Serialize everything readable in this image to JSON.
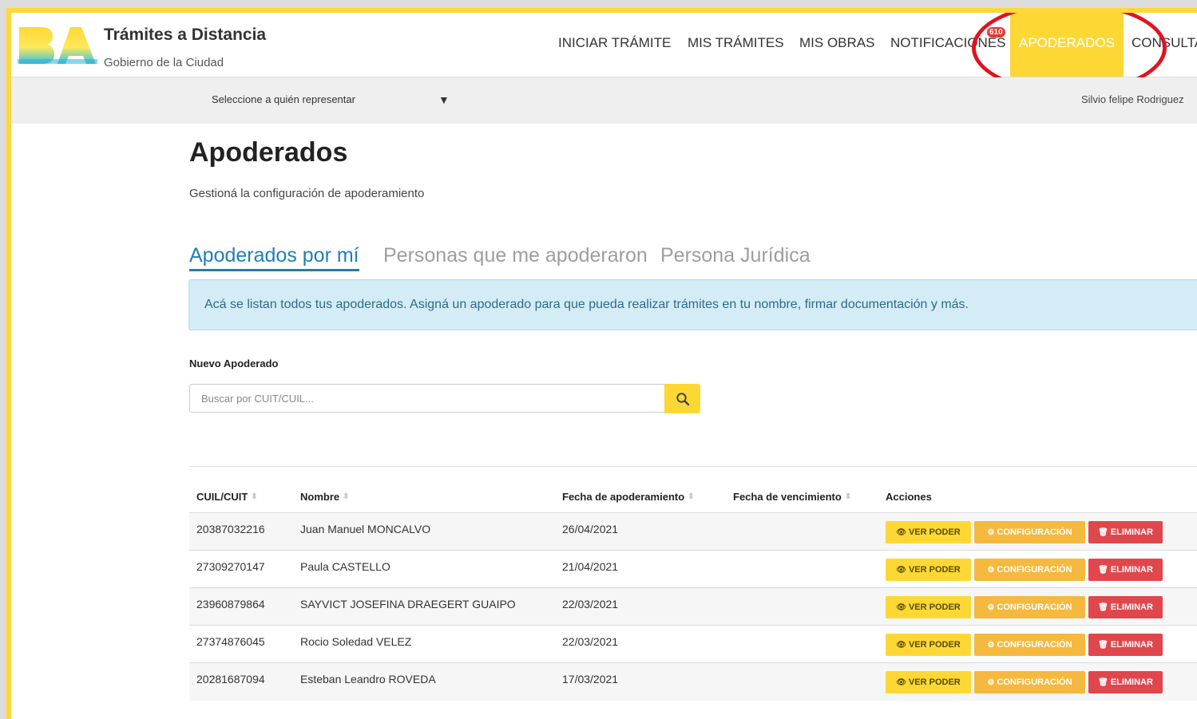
{
  "app": {
    "title": "Trámites a Distancia",
    "subtitle": "Gobierno de la Ciudad",
    "logo_text": "BA"
  },
  "nav": {
    "items": [
      {
        "label": "INICIAR TRÁMITE"
      },
      {
        "label": "MIS TRÁMITES"
      },
      {
        "label": "MIS OBRAS"
      },
      {
        "label": "NOTIFICACIONES",
        "badge": "610"
      },
      {
        "label": "APODERADOS",
        "active": true
      },
      {
        "label": "CONSULTA"
      }
    ]
  },
  "subbar": {
    "represent_label": "Seleccione a quién representar",
    "caret": "▼",
    "user_name": "Silvio felipe Rodriguez"
  },
  "page": {
    "title": "Apoderados",
    "description": "Gestioná la configuración de apoderamiento"
  },
  "tabs": [
    {
      "label": "Apoderados por mí",
      "active": true
    },
    {
      "label": "Personas que me apoderaron"
    },
    {
      "label": "Persona Jurídica"
    }
  ],
  "info": "Acá se listan todos tus apoderados. Asigná un apoderado para que pueda realizar trámites en tu nombre, firmar documentación y más.",
  "new_apoderado": {
    "label": "Nuevo Apoderado",
    "placeholder": "Buscar por CUIT/CUIL..."
  },
  "table": {
    "headers": [
      "CUIL/CUIT",
      "Nombre",
      "Fecha de apoderamiento",
      "Fecha de vencimiento",
      "Acciones"
    ],
    "sort_icon": "⬍",
    "rows": [
      {
        "cuil": "20387032216",
        "nombre": "Juan Manuel MONCALVO",
        "fecha": "26/04/2021"
      },
      {
        "cuil": "27309270147",
        "nombre": "Paula CASTELLO",
        "fecha": "21/04/2021"
      },
      {
        "cuil": "23960879864",
        "nombre": "SAYVICT JOSEFINA DRAEGERT GUAIPO",
        "fecha": "22/03/2021"
      },
      {
        "cuil": "27374876045",
        "nombre": "Rocio Soledad VELEZ",
        "fecha": "22/03/2021"
      },
      {
        "cuil": "20281687094",
        "nombre": "Esteban Leandro ROVEDA",
        "fecha": "17/03/2021"
      }
    ],
    "actions": {
      "view": "VER PODER",
      "config": "CONFIGURACIÓN",
      "delete": "ELIMINAR"
    }
  },
  "colors": {
    "brand_yellow": "#fdd835",
    "highlight_red": "#e0131f",
    "tab_active": "#1f7fb4",
    "danger": "#e0474c",
    "warning": "#f5b93f"
  }
}
